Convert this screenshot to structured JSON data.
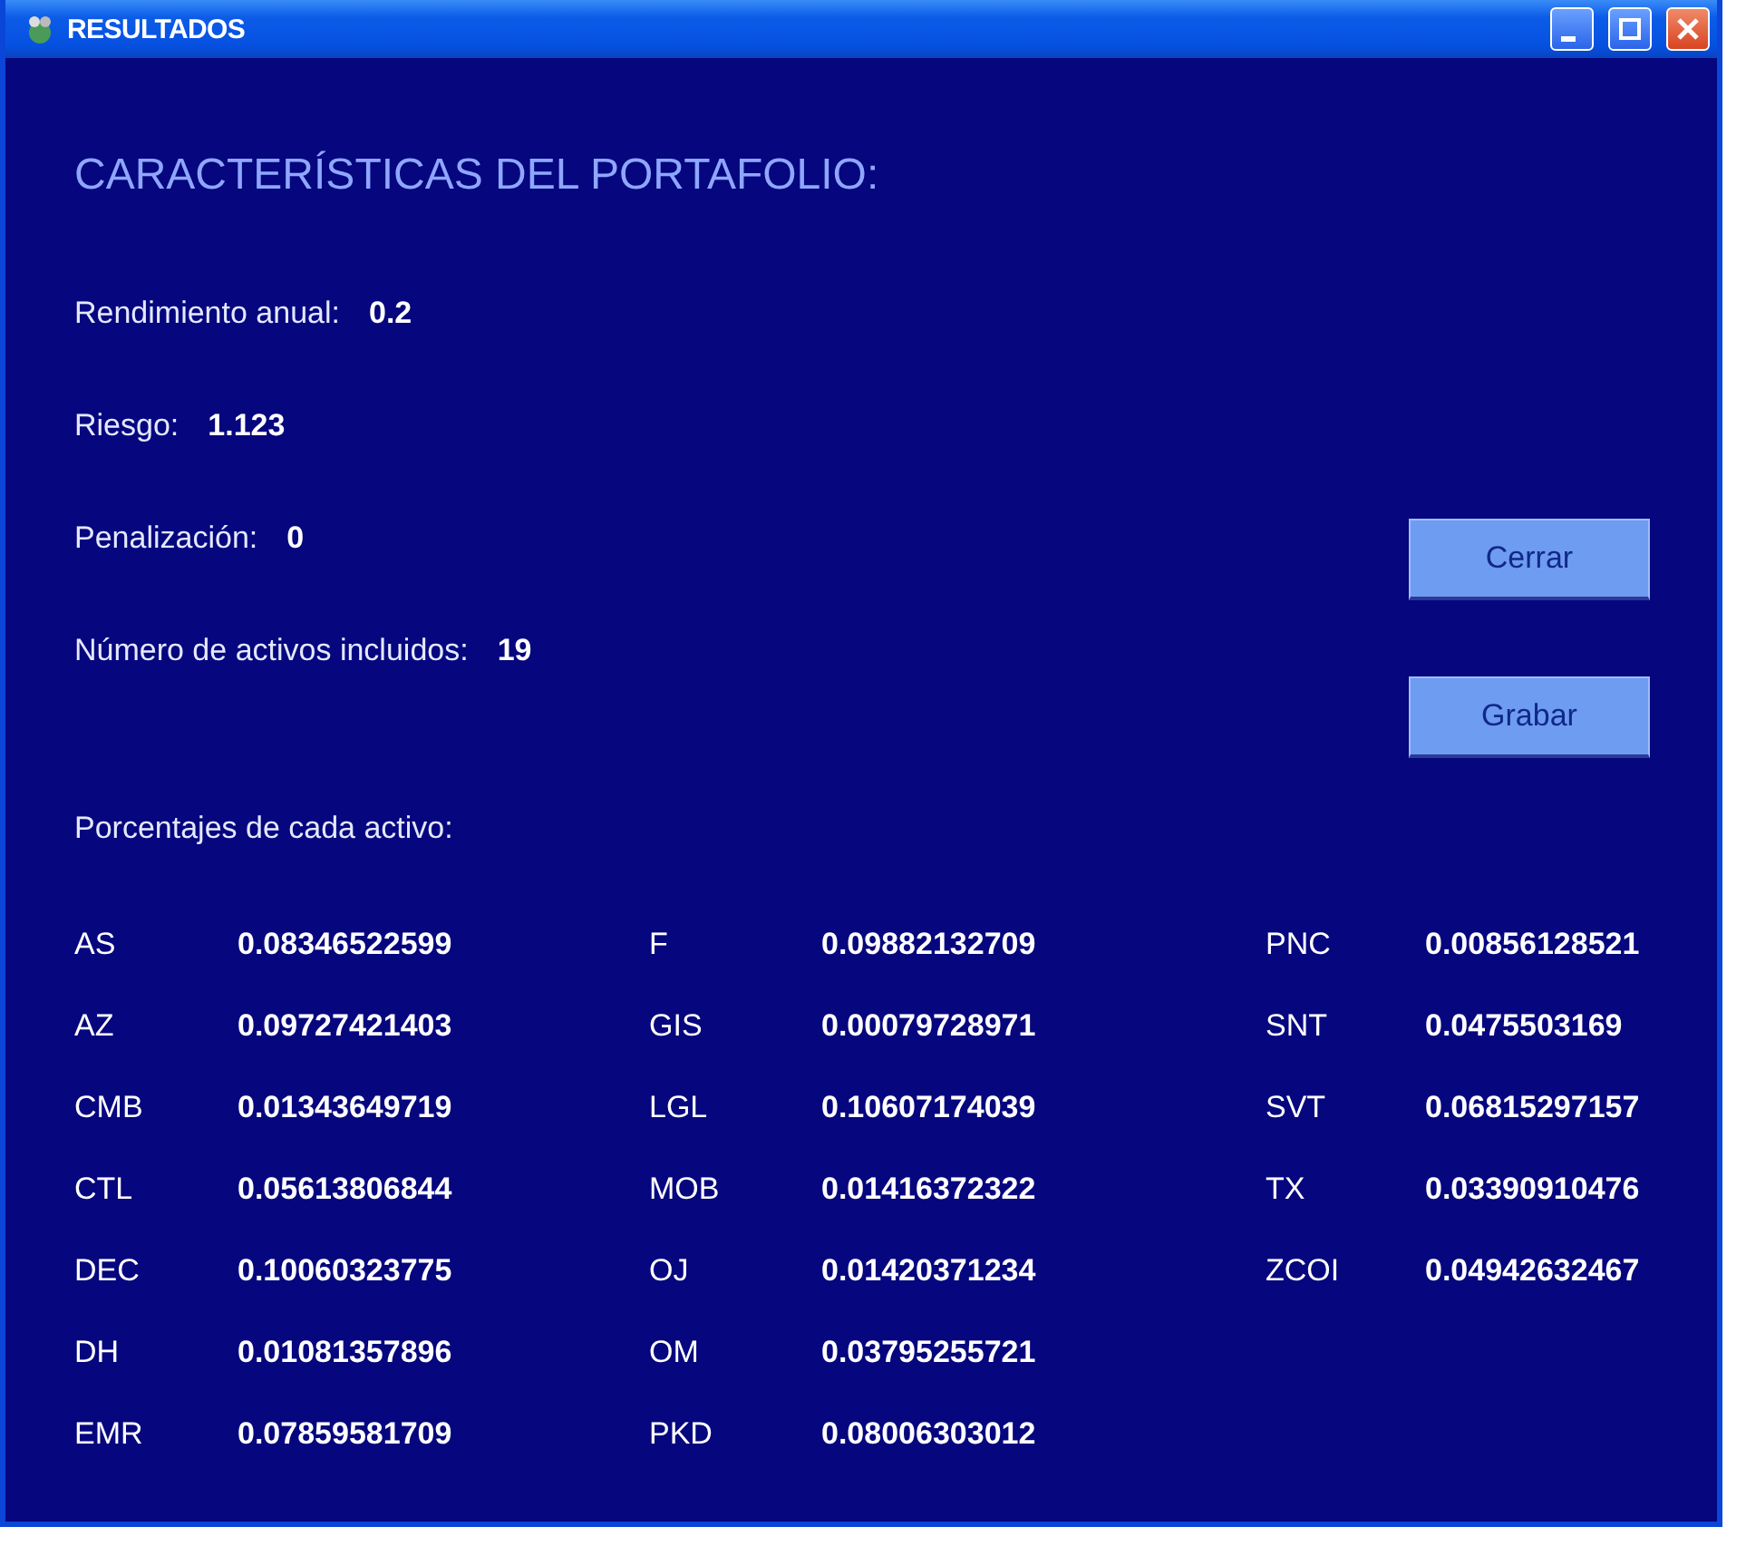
{
  "window": {
    "title": "RESULTADOS"
  },
  "heading": "CARACTERÍSTICAS DEL PORTAFOLIO:",
  "stats": [
    {
      "label": "Rendimiento anual:",
      "value": "0.2"
    },
    {
      "label": "Riesgo:",
      "value": "1.123"
    },
    {
      "label": "Penalización:",
      "value": "0"
    },
    {
      "label": "Número de activos incluidos:",
      "value": "19"
    }
  ],
  "buttons": [
    "Cerrar",
    "Grabar"
  ],
  "percentages_label": "Porcentajes de cada activo:",
  "assets": [
    {
      "name": "AS",
      "value": "0.08346522599"
    },
    {
      "name": "AZ",
      "value": "0.09727421403"
    },
    {
      "name": "CMB",
      "value": "0.01343649719"
    },
    {
      "name": "CTL",
      "value": "0.05613806844"
    },
    {
      "name": "DEC",
      "value": "0.10060323775"
    },
    {
      "name": "DH",
      "value": "0.01081357896"
    },
    {
      "name": "EMR",
      "value": "0.07859581709"
    },
    {
      "name": "F",
      "value": "0.09882132709"
    },
    {
      "name": "GIS",
      "value": "0.00079728971"
    },
    {
      "name": "LGL",
      "value": "0.10607174039"
    },
    {
      "name": "MOB",
      "value": "0.01416372322"
    },
    {
      "name": "OJ",
      "value": "0.01420371234"
    },
    {
      "name": "OM",
      "value": "0.03795255721"
    },
    {
      "name": "PKD",
      "value": "0.08006303012"
    },
    {
      "name": "PNC",
      "value": "0.00856128521"
    },
    {
      "name": "SNT",
      "value": "0.0475503169"
    },
    {
      "name": "SVT",
      "value": "0.06815297157"
    },
    {
      "name": "TX",
      "value": "0.03390910476"
    },
    {
      "name": "ZCOI",
      "value": "0.04942632467"
    }
  ]
}
